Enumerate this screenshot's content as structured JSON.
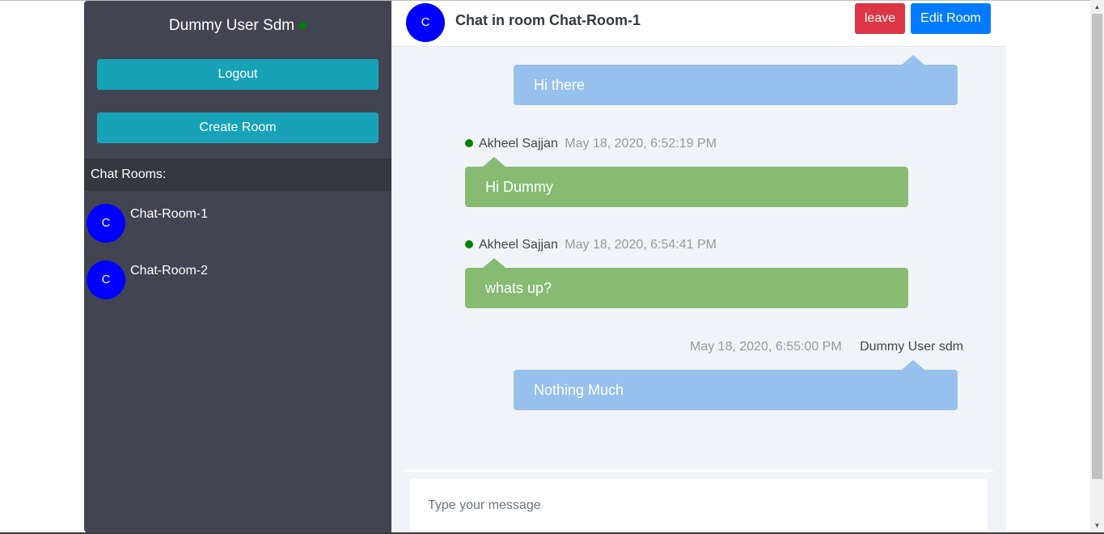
{
  "user": {
    "name": "Dummy User Sdm"
  },
  "sidebar": {
    "logout_label": "Logout",
    "create_room_label": "Create Room",
    "rooms_header": "Chat Rooms:",
    "rooms": [
      {
        "avatar": "C",
        "name": "Chat-Room-1"
      },
      {
        "avatar": "C",
        "name": "Chat-Room-2"
      }
    ]
  },
  "chat": {
    "avatar": "C",
    "title": "Chat in room Chat-Room-1",
    "leave_label": "leave",
    "edit_label": "Edit Room",
    "messages": [
      {
        "text": "Hi there",
        "own": true
      },
      {
        "sender": "Akheel Sajjan",
        "time": "May 18, 2020, 6:52:19 PM",
        "text": "Hi Dummy",
        "own": false
      },
      {
        "sender": "Akheel Sajjan",
        "time": "May 18, 2020, 6:54:41 PM",
        "text": "whats up?",
        "own": false
      },
      {
        "sender": "Dummy User sdm",
        "time": "May 18, 2020, 6:55:00 PM",
        "text": "Nothing Much",
        "own": true
      }
    ],
    "input": {
      "placeholder": "Type your message",
      "value": ""
    }
  },
  "icons": {
    "online_status": "online-dot-icon",
    "scroll_up": "scroll-up-arrow-icon",
    "scroll_down": "scroll-down-arrow-icon"
  },
  "colors": {
    "sidebar_bg": "#434452",
    "primary_teal": "#17a2b8",
    "avatar_blue": "#0000ff",
    "leave_red": "#dc3545",
    "edit_blue": "#007bff",
    "own_bubble": "#95c1ec",
    "other_bubble": "#86bb71",
    "online_green": "#008000"
  }
}
